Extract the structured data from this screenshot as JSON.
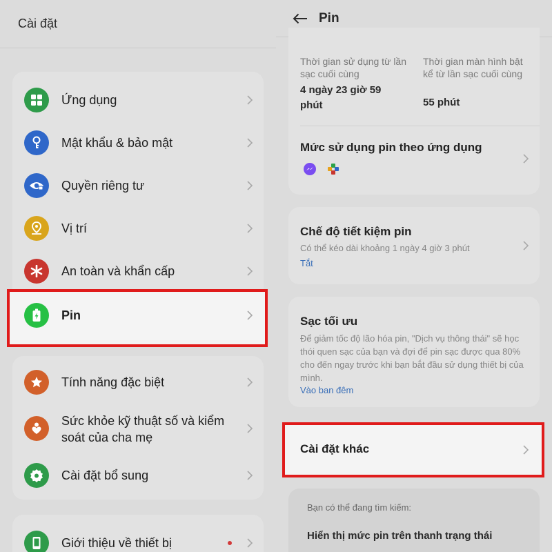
{
  "left": {
    "header_title": "Cài đặt",
    "group1": [
      {
        "label": "Ứng dụng",
        "icon": "apps-grid-icon",
        "color": "#2e9b4a"
      },
      {
        "label": "Mật khẩu & bảo mật",
        "icon": "key-icon",
        "color": "#2f67c9"
      },
      {
        "label": "Quyền riêng tư",
        "icon": "privacy-eye-icon",
        "color": "#2f67c9"
      },
      {
        "label": "Vị trí",
        "icon": "location-pin-icon",
        "color": "#d9a51c"
      },
      {
        "label": "An toàn và khẩn cấp",
        "icon": "asterisk-icon",
        "color": "#c8362f"
      },
      {
        "label": "Pin",
        "icon": "battery-icon",
        "color": "#26c044"
      }
    ],
    "group2": [
      {
        "label": "Tính năng đặc biệt",
        "icon": "star-icon",
        "color": "#d2602a"
      },
      {
        "label": "Sức khỏe kỹ thuật số và kiểm soát của cha mẹ",
        "icon": "heart-person-icon",
        "color": "#d2602a"
      },
      {
        "label": "Cài đặt bổ sung",
        "icon": "gear-icon",
        "color": "#2e9b4a"
      }
    ],
    "group3": [
      {
        "label": "Giới thiệu về thiết bị",
        "icon": "phone-icon",
        "color": "#2e9b4a"
      }
    ]
  },
  "right": {
    "header_title": "Pin",
    "usage": {
      "since_charge_label": "Thời gian sử dụng từ lần sạc cuối cùng",
      "since_charge_value": "4 ngày 23 giờ 59 phút",
      "screen_label": "Thời gian màn hình bật kể từ lần sạc cuối cùng",
      "screen_value": "55 phút"
    },
    "app_usage_title": "Mức sử dụng pin theo ứng dụng",
    "saver": {
      "title": "Chế độ tiết kiệm pin",
      "desc": "Có thể kéo dài khoảng 1 ngày 4 giờ 3 phút",
      "status": "Tắt"
    },
    "optimized": {
      "title": "Sạc tối ưu",
      "desc": "Để giảm tốc độ lão hóa pin, \"Dịch vụ thông thái\" sẽ học thói quen sạc của bạn và đợi để pin sạc được qua 80% cho đến ngay trước khi bạn bắt đầu sử dụng thiết bị của mình.",
      "status": "Vào ban đêm"
    },
    "other_settings": "Cài đặt khác",
    "suggest": {
      "heading": "Bạn có thể đang tìm kiếm:",
      "item": "Hiển thị mức pin trên thanh trạng thái"
    }
  },
  "colors": {
    "highlight": "#e01b1b",
    "link": "#3a6fb8"
  }
}
